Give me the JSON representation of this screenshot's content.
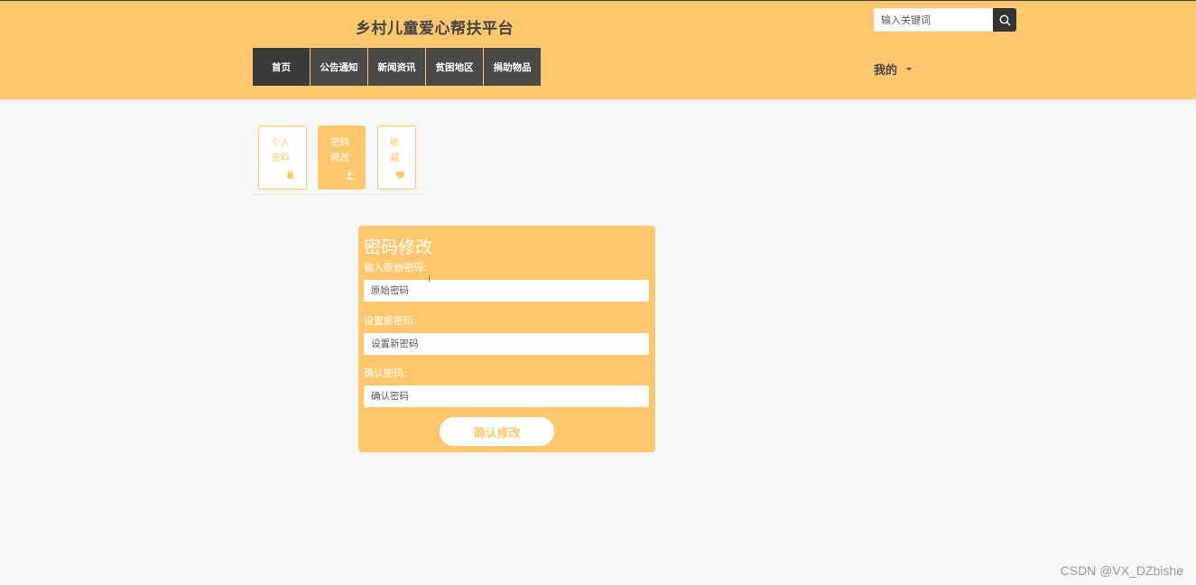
{
  "header": {
    "title": "乡村儿童爱心帮扶平台",
    "search_placeholder": "输入关键词",
    "search_icon": "search-icon",
    "nav": [
      "首页",
      "公告通知",
      "新闻资讯",
      "贫困地区",
      "捐助物品"
    ],
    "user_menu": "我的"
  },
  "side_tabs": [
    {
      "line1": "个人",
      "line2": "资料",
      "icon": "hand-icon"
    },
    {
      "line1": "密码",
      "line2": "修改",
      "icon": "user-icon"
    },
    {
      "line1": "收",
      "line2": "藏",
      "icon": "heart-icon"
    }
  ],
  "form": {
    "title": "密码修改",
    "old_label": "输入原始密码:",
    "old_placeholder": "原始密码",
    "new_label": "设置新密码:",
    "new_placeholder": "设置新密码",
    "confirm_label": "确认密码:",
    "confirm_placeholder": "确认密码",
    "submit": "确认修改"
  },
  "watermark": "CSDN @VX_DZbishe",
  "colors": {
    "accent": "#fec76e",
    "nav_bg": "#4a4a4a",
    "text": "#444444"
  }
}
